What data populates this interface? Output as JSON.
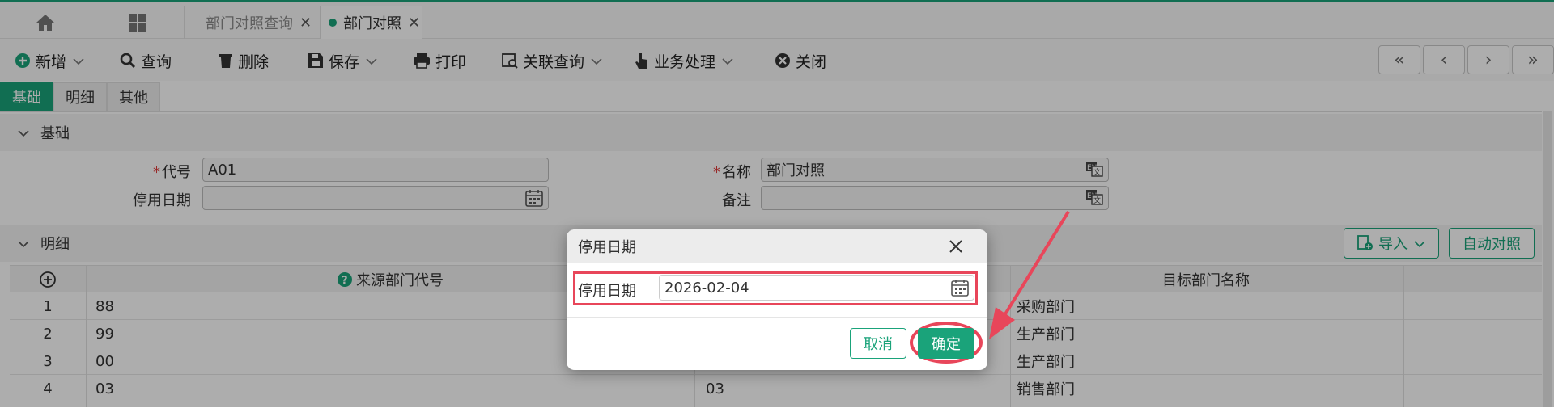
{
  "tabs": [
    {
      "label": "部门对照查询",
      "active": false
    },
    {
      "label": "部门对照",
      "active": true
    }
  ],
  "toolbar": {
    "add": "新增",
    "query": "查询",
    "delete": "删除",
    "save": "保存",
    "print": "打印",
    "related_query": "关联查询",
    "business": "业务处理",
    "close": "关闭"
  },
  "pager": {
    "first": "«",
    "prev": "‹",
    "next": "›",
    "last": "»"
  },
  "subtabs": [
    "基础",
    "明细",
    "其他"
  ],
  "basic": {
    "section": "基础",
    "code_label": "代号",
    "code_value": "A01",
    "name_label": "名称",
    "name_value": "部门对照",
    "stop_date_label": "停用日期",
    "stop_date_value": "",
    "remark_label": "备注",
    "remark_value": ""
  },
  "detail": {
    "section": "明细",
    "import": "导入",
    "auto_match": "自动对照",
    "columns": {
      "source_code": "来源部门代号",
      "target_name": "目标部门名称"
    },
    "rows": [
      {
        "no": "1",
        "source": "88",
        "target_code": "",
        "target_name": "采购部门"
      },
      {
        "no": "2",
        "source": "99",
        "target_code": "",
        "target_name": "生产部门"
      },
      {
        "no": "3",
        "source": "00",
        "target_code": "",
        "target_name": "生产部门"
      },
      {
        "no": "4",
        "source": "03",
        "target_code": "03",
        "target_name": "销售部门"
      }
    ]
  },
  "dialog": {
    "title": "停用日期",
    "field_label": "停用日期",
    "field_value": "2026-02-04",
    "cancel": "取消",
    "ok": "确定"
  },
  "colors": {
    "accent": "#1aa37a",
    "highlight": "#e8465a"
  }
}
